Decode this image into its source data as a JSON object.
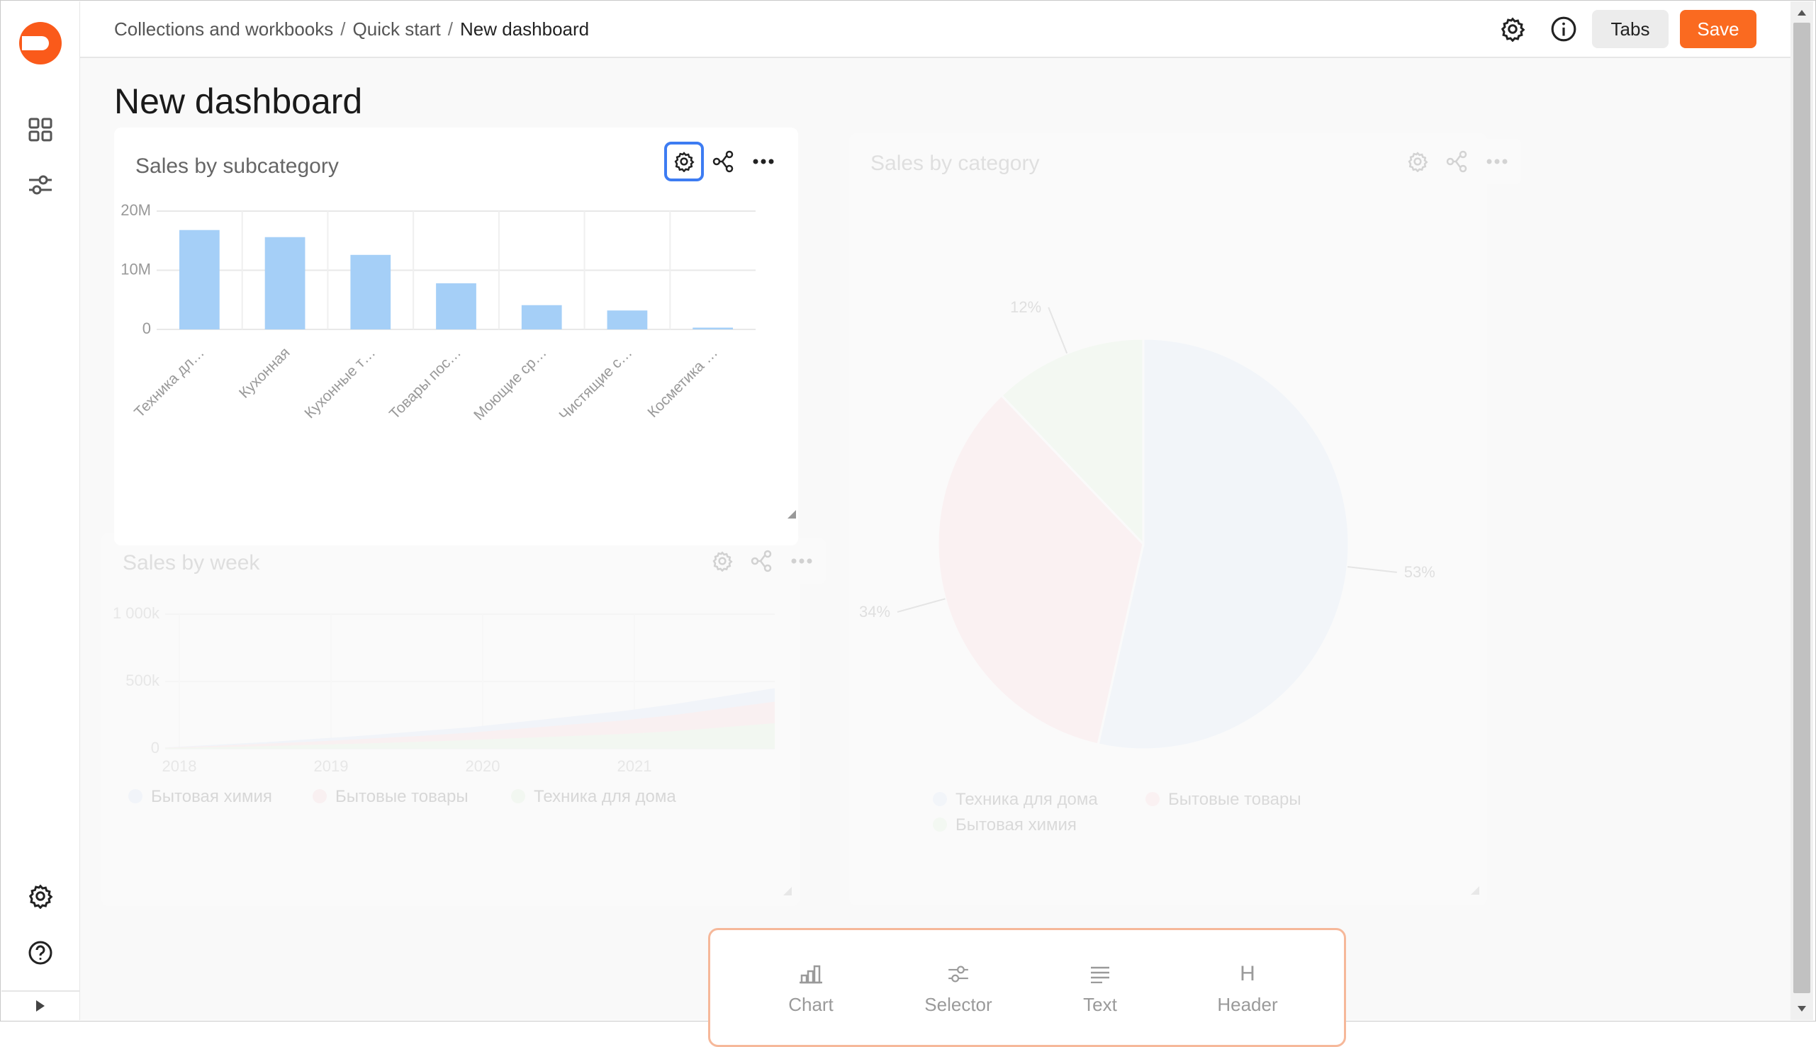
{
  "breadcrumb": {
    "items": [
      "Collections and workbooks",
      "Quick start"
    ],
    "separator": "/",
    "current": "New dashboard"
  },
  "toolbar": {
    "tabs_label": "Tabs",
    "save_label": "Save"
  },
  "page_title": "New dashboard",
  "colors": {
    "accent": "#fa6a20",
    "bar": "#a5cff7",
    "pie_blue": "#cfe3fa",
    "pie_pink": "#fbc9d2",
    "pie_green": "#d7f3cf",
    "selection": "#3d7cf2"
  },
  "widgets": {
    "subcategory": {
      "title": "Sales by subcategory"
    },
    "category": {
      "title": "Sales by category"
    },
    "week": {
      "title": "Sales by week"
    }
  },
  "add_panel": {
    "items": [
      {
        "label": "Chart",
        "icon": "chart-icon"
      },
      {
        "label": "Selector",
        "icon": "selector-icon"
      },
      {
        "label": "Text",
        "icon": "text-icon"
      },
      {
        "label": "Header",
        "icon": "header-icon",
        "glyph": "H"
      }
    ]
  },
  "chart_data": [
    {
      "type": "bar",
      "title": "Sales by subcategory",
      "categories": [
        "Техника дл…",
        "Кухонная",
        "Кухонные т…",
        "Товары пос…",
        "Моющие ср…",
        "Чистящие с…",
        "Косметика …"
      ],
      "values": [
        16.8,
        15.6,
        12.6,
        7.8,
        4.1,
        3.2,
        0.3
      ],
      "y_tick_labels": [
        "20M",
        "10M",
        "0"
      ],
      "ylim": [
        0,
        20
      ],
      "grid": true
    },
    {
      "type": "pie",
      "title": "Sales by category",
      "slices": [
        {
          "name": "Техника для дома",
          "value": 53,
          "label": "53%"
        },
        {
          "name": "Бытовые товары",
          "value": 34,
          "label": "34%"
        },
        {
          "name": "Бытовая химия",
          "value": 12,
          "label": "12%"
        }
      ],
      "legend": [
        "Техника для дома",
        "Бытовые товары",
        "Бытовая химия"
      ],
      "legend_position": "bottom"
    },
    {
      "type": "area",
      "title": "Sales by week",
      "x_tick_labels": [
        "2018",
        "2019",
        "2020",
        "2021"
      ],
      "y_tick_labels": [
        "1 000k",
        "500k",
        "0"
      ],
      "ylim": [
        0,
        1000
      ],
      "series": [
        {
          "name": "Бытовая химия",
          "values": [
            10,
            30,
            50,
            75,
            100,
            130,
            160,
            200,
            240,
            280,
            330,
            390,
            450
          ]
        },
        {
          "name": "Бытовые товары",
          "values": [
            8,
            22,
            38,
            55,
            75,
            95,
            120,
            150,
            180,
            210,
            250,
            300,
            350
          ]
        },
        {
          "name": "Техника для дома",
          "values": [
            5,
            12,
            20,
            30,
            40,
            52,
            65,
            80,
            95,
            110,
            130,
            160,
            190
          ]
        }
      ],
      "legend_position": "bottom"
    }
  ]
}
